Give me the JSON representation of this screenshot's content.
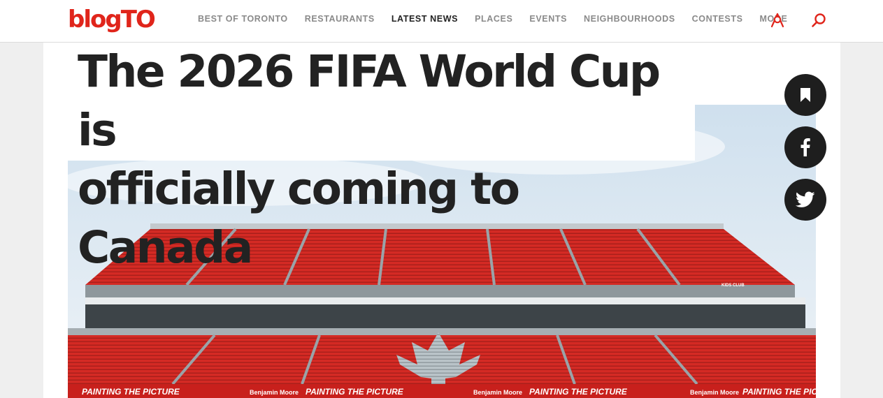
{
  "site": {
    "logo": "blogTO"
  },
  "nav": {
    "items": [
      "BEST OF TORONTO",
      "RESTAURANTS",
      "LATEST NEWS",
      "PLACES",
      "EVENTS",
      "NEIGHBOURHOODS",
      "CONTESTS",
      "MORE"
    ],
    "active": "LATEST NEWS"
  },
  "icons": {
    "account": "user-icon",
    "search": "search-icon",
    "bookmark": "bookmark-icon",
    "facebook": "facebook-icon",
    "twitter": "twitter-icon"
  },
  "article": {
    "title_line1": "The 2026 FIFA World Cup is",
    "title_line2": "officially coming to Canada",
    "banner_text": "PAINTING THE PICTURE",
    "banner_brand": "Benjamin Moore",
    "box_label": "KIDS CLUB"
  },
  "colors": {
    "brand": "#e0251b",
    "seat_red": "#d42a24",
    "share_bg": "#1e1e1e"
  }
}
